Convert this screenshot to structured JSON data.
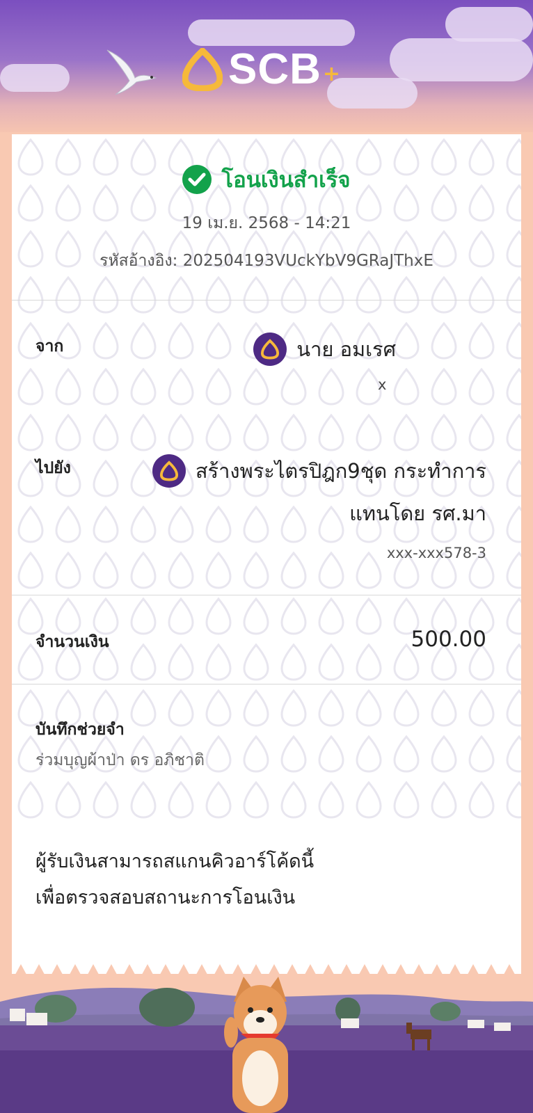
{
  "brand": {
    "name": "SCB",
    "plus": "+"
  },
  "status": {
    "text": "โอนเงินสำเร็จ"
  },
  "datetime": "19 เม.ย. 2568 - 14:21",
  "reference": "รหัสอ้างอิง: 202504193VUckYbV9GRaJThxE",
  "from": {
    "label": "จาก",
    "name": "นาย อมเรศ",
    "account": "x"
  },
  "to": {
    "label": "ไปยัง",
    "name_line1": "สร้างพระไตรปิฎก9ชุด กระทำการ",
    "name_line2": "แทนโดย รศ.มา",
    "account": "xxx-xxx578-3"
  },
  "amount": {
    "label": "จำนวนเงิน",
    "value": "500.00"
  },
  "memo": {
    "label": "บันทึกช่วยจำ",
    "value": "ร่วมบุญผ้าป่า ดร อภิชาติ"
  },
  "qr_message": {
    "line1": "ผู้รับเงินสามารถสแกนคิวอาร์โค้ดนี้",
    "line2": "เพื่อตรวจสอบสถานะการโอนเงิน"
  },
  "colors": {
    "success": "#13a24b",
    "brand_purple": "#4e2a84",
    "brand_gold": "#f6b93b",
    "peach": "#f9c9b2"
  }
}
